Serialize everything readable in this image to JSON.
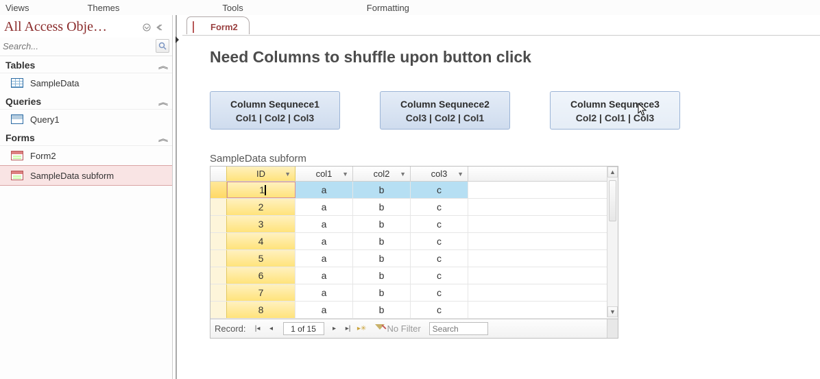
{
  "menubar": {
    "items": [
      "Views",
      "Themes",
      "Tools",
      "Formatting"
    ]
  },
  "nav": {
    "title": "All Access Obje…",
    "search_placeholder": "Search...",
    "categories": [
      {
        "name": "Tables",
        "items": [
          {
            "label": "SampleData",
            "type": "table"
          }
        ]
      },
      {
        "name": "Queries",
        "items": [
          {
            "label": "Query1",
            "type": "query"
          }
        ]
      },
      {
        "name": "Forms",
        "items": [
          {
            "label": "Form2",
            "type": "form",
            "selected": false
          },
          {
            "label": "SampleData subform",
            "type": "form",
            "selected": true
          }
        ]
      }
    ]
  },
  "tab": {
    "label": "Form2"
  },
  "form": {
    "title": "Need Columns to shuffle upon button click",
    "buttons": [
      {
        "title": "Column Sequnece1",
        "seq": "Col1 | Col2 | Col3"
      },
      {
        "title": "Column Sequnece2",
        "seq": "Col3 | Col2 | Col1"
      },
      {
        "title": "Column Sequnece3",
        "seq": "Col2 | Col1 | Col3"
      }
    ],
    "subform_label": "SampleData subform"
  },
  "datasheet": {
    "columns": [
      "ID",
      "col1",
      "col2",
      "col3"
    ],
    "rows": [
      {
        "id": "1",
        "c1": "a",
        "c2": "b",
        "c3": "c"
      },
      {
        "id": "2",
        "c1": "a",
        "c2": "b",
        "c3": "c"
      },
      {
        "id": "3",
        "c1": "a",
        "c2": "b",
        "c3": "c"
      },
      {
        "id": "4",
        "c1": "a",
        "c2": "b",
        "c3": "c"
      },
      {
        "id": "5",
        "c1": "a",
        "c2": "b",
        "c3": "c"
      },
      {
        "id": "6",
        "c1": "a",
        "c2": "b",
        "c3": "c"
      },
      {
        "id": "7",
        "c1": "a",
        "c2": "b",
        "c3": "c"
      },
      {
        "id": "8",
        "c1": "a",
        "c2": "b",
        "c3": "c"
      }
    ]
  },
  "recnav": {
    "label": "Record:",
    "pos": "1 of 15",
    "filter_label": "No Filter",
    "search_placeholder": "Search"
  }
}
